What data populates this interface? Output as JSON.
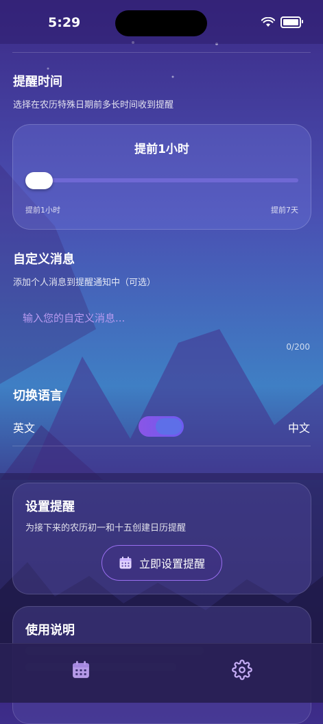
{
  "status_bar": {
    "time": "5:29"
  },
  "reminder_time": {
    "title": "提醒时间",
    "description": "选择在农历特殊日期前多长时间收到提醒",
    "selected_label": "提前1小时",
    "slider_level": 0,
    "min_label": "提前1小时",
    "max_label": "提前7天"
  },
  "custom_message": {
    "title": "自定义消息",
    "description": "添加个人消息到提醒通知中（可选）",
    "placeholder": "输入您的自定义消息...",
    "value": "",
    "counter": "0/200"
  },
  "language": {
    "title": "切换语言",
    "left_label": "英文",
    "right_label": "中文",
    "toggle_on": true
  },
  "setup_card": {
    "title": "设置提醒",
    "description": "为接下来的农历初一和十五创建日历提醒",
    "button_label": "立即设置提醒",
    "button_icon": "calendar-icon"
  },
  "usage_card": {
    "title": "使用说明"
  },
  "tab_bar": {
    "items": [
      {
        "icon": "calendar-icon",
        "active": false
      },
      {
        "icon": "gear-icon",
        "active": true
      }
    ]
  },
  "colors": {
    "accent_purple": "#9a6ff0",
    "placeholder_purple": "#b79af0",
    "toggle_blue": "#5e6fe8"
  }
}
